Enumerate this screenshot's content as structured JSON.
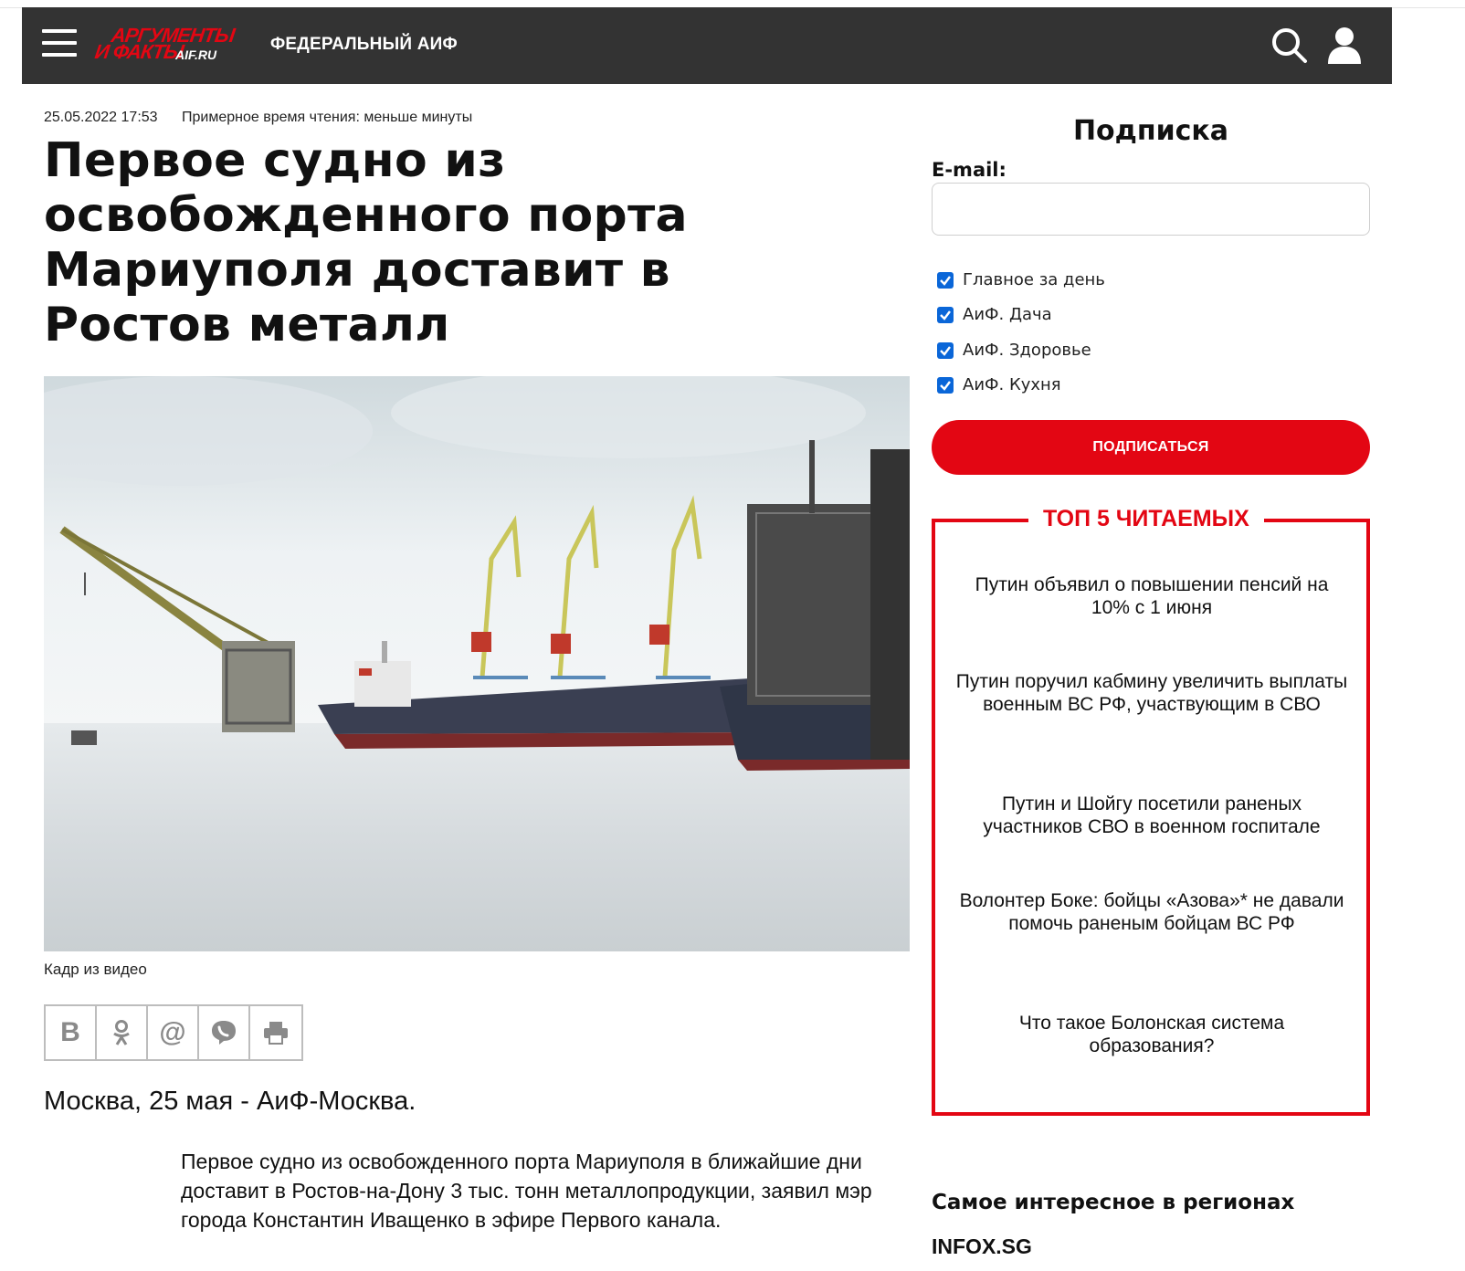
{
  "header": {
    "logo_line1": "АРГУМЕНТЫ",
    "logo_line2": "И ФАКТЫ",
    "logo_domain": "AIF.RU",
    "nav_label": "ФЕДЕРАЛЬНЫЙ АИФ"
  },
  "article": {
    "date": "25.05.2022 17:53",
    "reading_time": "Примерное время чтения: меньше минуты",
    "title": "Первое судно из освобожденного порта Мариуполя доставит в Ростов металл",
    "photo_caption": "Кадр из видео",
    "lead": "Москва, 25 мая - АиФ-Москва.",
    "body": "Первое судно из освобожденного порта Мариуполя в ближайшие дни доставит в Ростов-на-Дону 3 тыс. тонн металлопродукции, заявил мэр города Константин Иващенко в эфире Первого канала.",
    "share_buttons": [
      "vk",
      "ok",
      "mail",
      "viber",
      "print"
    ]
  },
  "subscription": {
    "title": "Подписка",
    "email_label": "E-mail:",
    "email_value": "",
    "options": [
      {
        "label": "Главное за день",
        "checked": true
      },
      {
        "label": "АиФ. Дача",
        "checked": true
      },
      {
        "label": "АиФ. Здоровье",
        "checked": true
      },
      {
        "label": "АиФ. Кухня",
        "checked": true
      }
    ],
    "button_label": "ПОДПИСАТЬСЯ"
  },
  "top5": {
    "title": "ТОП 5 ЧИТАЕМЫХ",
    "items": [
      "Путин объявил о повышении пенсий на 10% с 1 июня",
      "Путин поручил кабмину увеличить выплаты военным ВС РФ, участвующим в СВО",
      "Путин и Шойгу посетили раненых участников СВО в военном госпитале",
      "Волонтер Боке: бойцы «Азова»* не давали помочь раненым бойцам ВС РФ",
      "Что такое Болонская система образования?"
    ]
  },
  "regions": {
    "title": "Самое интересное в регионах",
    "source": "INFOX.SG"
  },
  "colors": {
    "brand_red": "#e30613",
    "header_bg": "#333333",
    "checkbox_blue": "#0a66d8"
  }
}
